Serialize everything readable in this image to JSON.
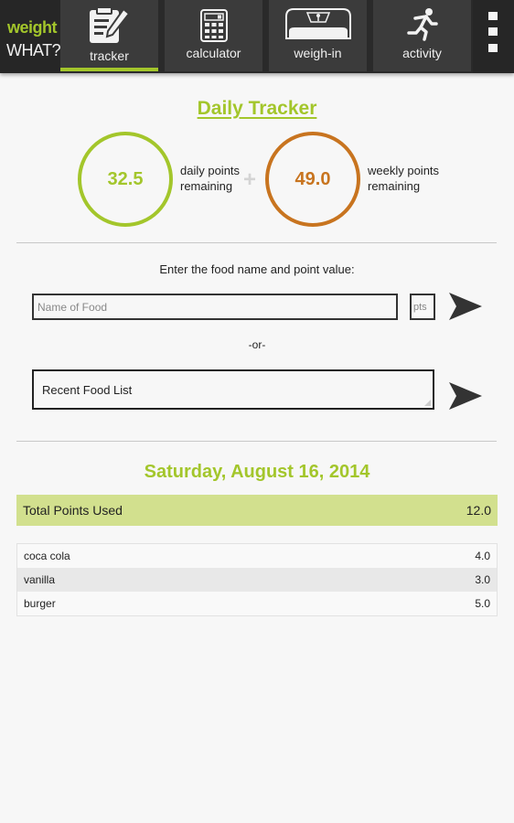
{
  "app": {
    "logo_line1": "weight",
    "logo_line2": "WHAT?"
  },
  "nav": {
    "tabs": [
      {
        "label": "tracker",
        "icon": "notepad-pencil-icon",
        "active": true
      },
      {
        "label": "calculator",
        "icon": "calculator-icon",
        "active": false
      },
      {
        "label": "weigh-in",
        "icon": "scale-icon",
        "active": false
      },
      {
        "label": "activity",
        "icon": "running-person-icon",
        "active": false
      }
    ],
    "overflow_icon": "overflow-menu-icon"
  },
  "tracker": {
    "title": "Daily Tracker",
    "daily_points": "32.5",
    "daily_label_line1": "daily points",
    "daily_label_line2": "remaining",
    "plus": "+",
    "weekly_points": "49.0",
    "weekly_label_line1": "weekly points",
    "weekly_label_line2": "remaining"
  },
  "entry": {
    "prompt": "Enter the food name and point value:",
    "food_placeholder": "Name of Food",
    "food_value": "",
    "pts_placeholder": "pts",
    "pts_value": "",
    "or_text": "-or-",
    "recent_selected": "Recent Food List"
  },
  "log": {
    "date": "Saturday, August 16, 2014",
    "total_label": "Total Points Used",
    "total_value": "12.0",
    "items": [
      {
        "name": "coca cola",
        "points": "4.0"
      },
      {
        "name": "vanilla",
        "points": "3.0"
      },
      {
        "name": "burger",
        "points": "5.0"
      }
    ]
  },
  "colors": {
    "accent_green": "#a3c62b",
    "accent_orange": "#c8741f",
    "total_bar": "#d2e08e",
    "nav_bg": "#3b3b3b"
  }
}
